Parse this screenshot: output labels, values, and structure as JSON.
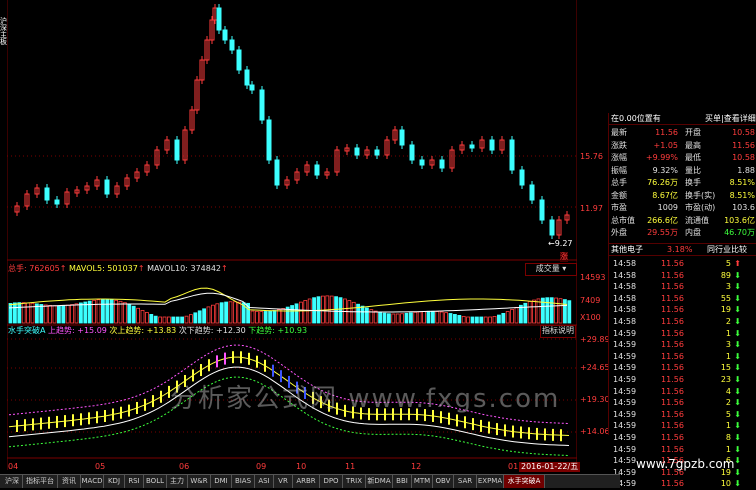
{
  "left_sidebar": {
    "label": "沪深主板"
  },
  "price_panel": {
    "y_ticks": [
      "15.76",
      "11.97"
    ],
    "low_marker": "9.27",
    "rise_tag": "涨"
  },
  "volume_panel": {
    "legend": {
      "total": "总手: 762605",
      "mavol5": "MAVOL5: 501037",
      "mavol10": "MAVOL10: 374842"
    },
    "button": "成交量",
    "y_ticks": [
      "14593",
      "7409",
      "X100"
    ]
  },
  "indicator_panel": {
    "legend": {
      "name": "水手突破A",
      "upper": "上趋势: +15.09",
      "second_upper": "次上趋势: +13.83",
      "second_lower": "次下趋势: +12.30",
      "lower": "下趋势: +10.93"
    },
    "button": "指标说明",
    "y_ticks": [
      "+29.89",
      "+24.65",
      "+19.30",
      "+14.06"
    ]
  },
  "x_axis": {
    "labels": [
      "04",
      "05",
      "06",
      "09",
      "10",
      "11",
      "12",
      "01"
    ],
    "date": "2016-01-22/五"
  },
  "watermark": "分析家公式网 www.fxgs.com",
  "right_panel": {
    "header": "在0.00位置有",
    "header_btn": "买单|查看详细",
    "stats": [
      {
        "k1": "最新",
        "v1": "11.56",
        "c1": "red",
        "k2": "开盘",
        "v2": "10.58",
        "c2": "red"
      },
      {
        "k1": "涨跌",
        "v1": "+1.05",
        "c1": "red",
        "k2": "最高",
        "v2": "11.56",
        "c2": "red"
      },
      {
        "k1": "涨幅",
        "v1": "+9.99%",
        "c1": "red",
        "k2": "最低",
        "v2": "10.58",
        "c2": "red"
      },
      {
        "k1": "振幅",
        "v1": "9.32%",
        "c1": "white",
        "k2": "量比",
        "v2": "1.88",
        "c2": "white"
      },
      {
        "k1": "总手",
        "v1": "76.26万",
        "c1": "yellow",
        "k2": "换手",
        "v2": "8.51%",
        "c2": "yellow"
      },
      {
        "k1": "金额",
        "v1": "8.67亿",
        "c1": "yellow",
        "k2": "换手(实)",
        "v2": "8.51%",
        "c2": "yellow"
      },
      {
        "k1": "市盈",
        "v1": "1009",
        "c1": "white",
        "k2": "市盈(动)",
        "v2": "103.6",
        "c2": "white"
      },
      {
        "k1": "总市值",
        "v1": "266.6亿",
        "c1": "yellow",
        "k2": "流通值",
        "v2": "103.6亿",
        "c2": "yellow"
      },
      {
        "k1": "外盘",
        "v1": "29.55万",
        "c1": "red",
        "k2": "内盘",
        "v2": "46.70万",
        "c2": "green"
      }
    ],
    "sector": {
      "name": "其他电子",
      "pct": "3.18%",
      "btn": "同行业比较"
    },
    "ticks": [
      {
        "t": "14:58",
        "p": "11.56",
        "v": "5",
        "d": "up"
      },
      {
        "t": "14:58",
        "p": "11.56",
        "v": "89",
        "d": "down"
      },
      {
        "t": "14:58",
        "p": "11.56",
        "v": "3",
        "d": "down"
      },
      {
        "t": "14:58",
        "p": "11.56",
        "v": "55",
        "d": "down"
      },
      {
        "t": "14:58",
        "p": "11.56",
        "v": "19",
        "d": "down"
      },
      {
        "t": "14:58",
        "p": "11.56",
        "v": "2",
        "d": "down"
      },
      {
        "t": "14:59",
        "p": "11.56",
        "v": "1",
        "d": "down"
      },
      {
        "t": "14:59",
        "p": "11.56",
        "v": "3",
        "d": "down"
      },
      {
        "t": "14:59",
        "p": "11.56",
        "v": "1",
        "d": "down"
      },
      {
        "t": "14:59",
        "p": "11.56",
        "v": "15",
        "d": "down"
      },
      {
        "t": "14:59",
        "p": "11.56",
        "v": "23",
        "d": "down"
      },
      {
        "t": "14:59",
        "p": "11.56",
        "v": "4",
        "d": "down"
      },
      {
        "t": "14:59",
        "p": "11.56",
        "v": "2",
        "d": "down"
      },
      {
        "t": "14:59",
        "p": "11.56",
        "v": "5",
        "d": "down"
      },
      {
        "t": "14:59",
        "p": "11.56",
        "v": "1",
        "d": "down"
      },
      {
        "t": "14:59",
        "p": "11.56",
        "v": "8",
        "d": "down"
      },
      {
        "t": "14:59",
        "p": "11.56",
        "v": "1",
        "d": "down"
      },
      {
        "t": "14:59",
        "p": "11.56",
        "v": "6",
        "d": "down"
      },
      {
        "t": "14:59",
        "p": "11.56",
        "v": "19",
        "d": "down"
      },
      {
        "t": "14:59",
        "p": "11.56",
        "v": "10",
        "d": "down"
      }
    ]
  },
  "tabs": [
    "沪深",
    "指标平台",
    "资讯",
    "MACD",
    "KDJ",
    "RSI",
    "BOLL",
    "主力",
    "W&R",
    "DMI",
    "BIAS",
    "ASI",
    "VR",
    "ARBR",
    "DPO",
    "TRIX",
    "新DMA",
    "BBI",
    "MTM",
    "OBV",
    "SAR",
    "EXPMA",
    "水手突破A"
  ],
  "site": "www.7gpzb.com",
  "colors": {
    "up": "#ff3c3c",
    "down": "#3cffff",
    "bg": "#000000",
    "grid": "#7a0000"
  }
}
